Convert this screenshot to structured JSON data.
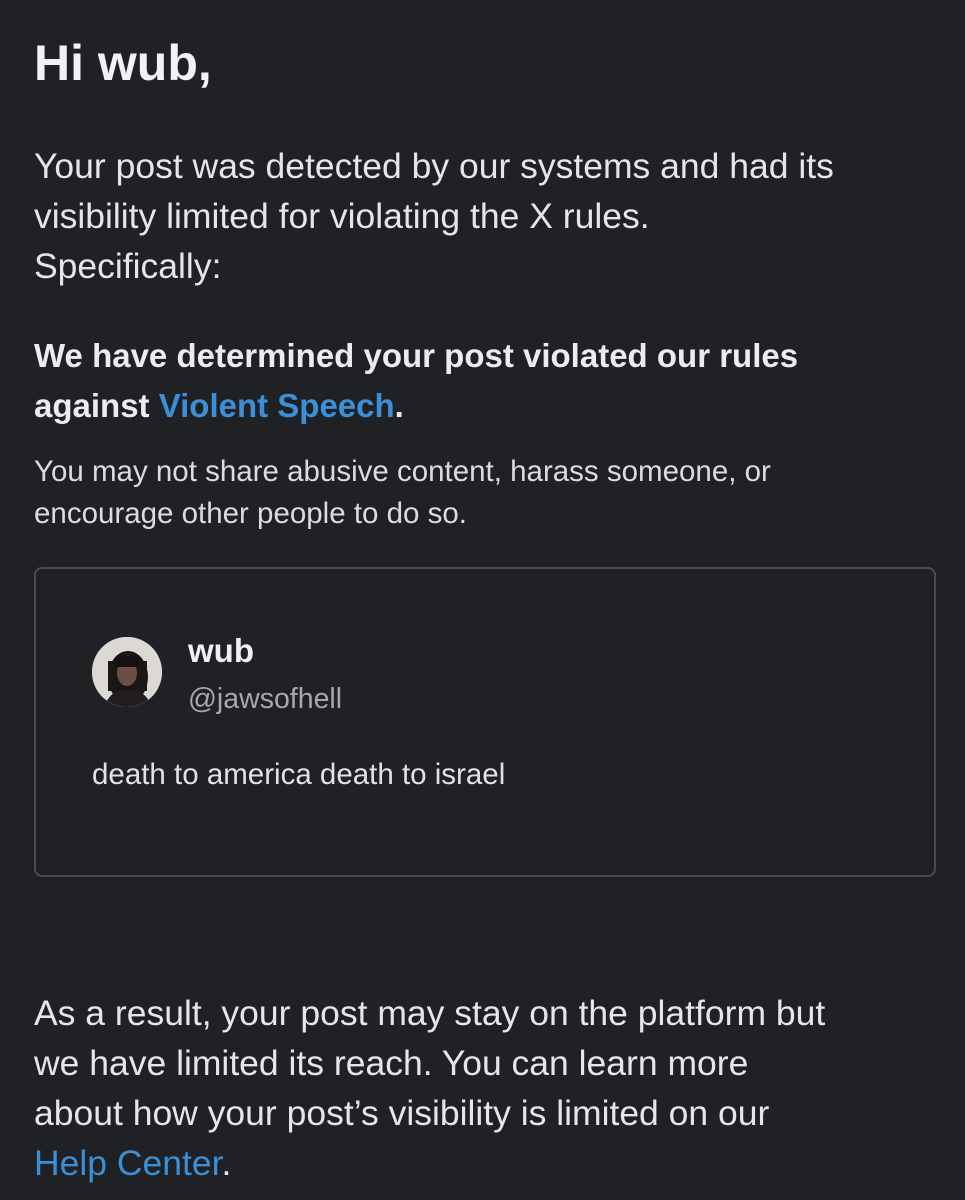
{
  "email": {
    "greeting": "Hi wub,",
    "intro_lines": [
      "Your post was detected by our systems and had its",
      "visibility limited for violating the X rules.",
      "Specifically:"
    ],
    "violation": {
      "line1": "We have determined your post violated our rules",
      "line2_prefix": "against ",
      "link_text": "Violent Speech",
      "line2_suffix": "."
    },
    "rule_description_lines": [
      "You may not share abusive content, harass someone, or",
      "encourage other people to do so."
    ],
    "post": {
      "display_name": "wub",
      "handle": "@jawsofhell",
      "text": "death to america death to israel"
    },
    "result": {
      "lines": [
        "As a result, your post may stay on the platform but",
        "we have limited its reach. You can learn more",
        "about how your post’s visibility is limited on our"
      ],
      "link_text": "Help Center",
      "suffix": "."
    }
  },
  "colors": {
    "background": "#202124",
    "text": "#e6e6e8",
    "link": "#3b8fd6",
    "muted": "#a6a8ad",
    "card_border": "#4a4c51"
  }
}
